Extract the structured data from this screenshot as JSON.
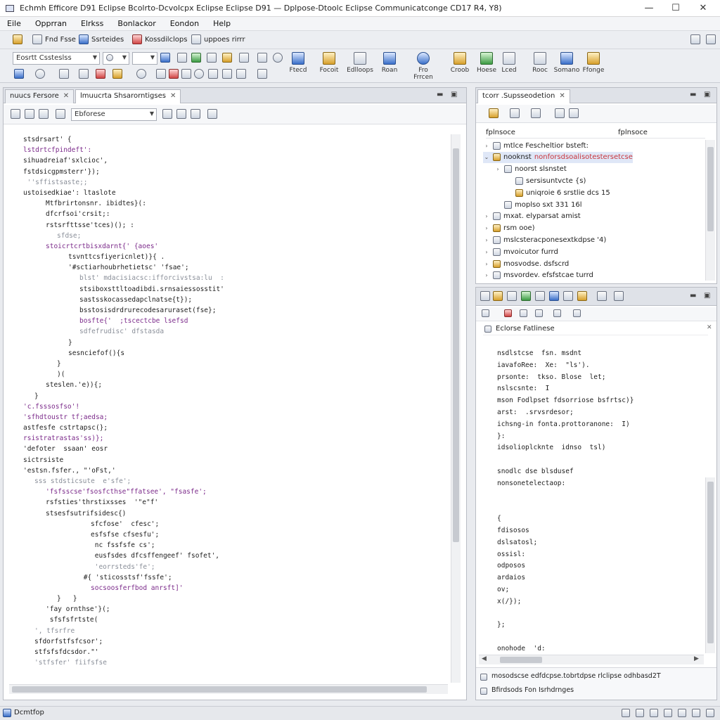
{
  "window": {
    "title": "Echmh Efficore D91 Eclipse Bcolrto-Dcvolcpx Eclipse Eclipse D91 — Dplpose-Dtoolc Eclipse Communicatconge CD17  R4, Y8)",
    "minimize": "—",
    "maximize": "☐",
    "close": "✕"
  },
  "menu": [
    "Eile",
    "Opprran",
    "Elrkss",
    "Bonlackor",
    "Eondon",
    "Help"
  ],
  "toolbar1": {
    "items": [
      "Fnd Fsse",
      "Ssrteides",
      "Kossdilclops",
      "uppoes rirrr"
    ]
  },
  "toolbar2": {
    "combo1": "Eosrtt Cssteslss",
    "combo2": "",
    "combo3": "",
    "big_buttons": [
      "Ftecd",
      "Focoit",
      "Edlloops",
      "Roan",
      "Fro Frrcen",
      "Croob",
      "Hoese",
      "Lced",
      "Rooc",
      "Somano",
      "Ffonge"
    ]
  },
  "editor": {
    "tabs": [
      {
        "label": "nuucs Fersore",
        "active": false
      },
      {
        "label": "lmuucrta Shsarorntigses",
        "active": true
      }
    ],
    "combo": "Ebforese",
    "lines": [
      {
        "indent": 2,
        "text": "stsdrsart' {",
        "color": "c-dark"
      },
      {
        "indent": 2,
        "text": "lstdrtcfpindeft':",
        "color": "c-purple"
      },
      {
        "indent": 2,
        "text": "sihuadreiaf'sxlcioc',",
        "color": "c-dark"
      },
      {
        "indent": 2,
        "text": "fstdsicgpmsterr'});",
        "color": "c-dark"
      },
      {
        "indent": 2,
        "text": " ''sffistsaste;;",
        "color": "c-grey"
      },
      {
        "indent": 2,
        "text": "ustoisedkiae': ltaslote",
        "color": "c-dark"
      },
      {
        "indent": 6,
        "text": "Mtfbrirtonsnr. ibidtes}(:",
        "color": "c-dark"
      },
      {
        "indent": 6,
        "text": "dfcrfsoi'crsit;:",
        "color": "c-dark"
      },
      {
        "indent": 6,
        "text": "rstsrfttsse'tces)(); :",
        "color": "c-dark"
      },
      {
        "indent": 8,
        "text": "sfdse;",
        "color": "c-grey"
      },
      {
        "indent": 6,
        "text": "stoicrtcrtbisxdarnt{' {aoes'",
        "color": "c-purple"
      },
      {
        "indent": 10,
        "text": "tsvnttcsfiyericnlet)}{ .",
        "color": "c-dark"
      },
      {
        "indent": 10,
        "text": "'#sctiarhoubrhetietsc' 'fsae';",
        "color": "c-dark"
      },
      {
        "indent": 12,
        "text": "blst' mdacisiacsc:ifforcivstsa:lu  :",
        "color": "c-grey"
      },
      {
        "indent": 12,
        "text": "stsiboxsttltoadibdi.srnsaiessosstit'",
        "color": "c-dark"
      },
      {
        "indent": 12,
        "text": "sastsskocassedapclnatse{t});",
        "color": "c-dark"
      },
      {
        "indent": 12,
        "text": "bsstosisdrdrurecodesaruraset(fse};",
        "color": "c-dark"
      },
      {
        "indent": 12,
        "text": "bosfte{'  ;tscectcbe lsefsd",
        "color": "c-purple"
      },
      {
        "indent": 12,
        "text": "sdfefrudisc' dfstasda",
        "color": "c-grey"
      },
      {
        "indent": 10,
        "text": "}",
        "color": "c-dark"
      },
      {
        "indent": 10,
        "text": "sesnciefof(){s",
        "color": "c-dark"
      },
      {
        "indent": 8,
        "text": "}",
        "color": "c-dark"
      },
      {
        "indent": 8,
        "text": ")(",
        "color": "c-dark"
      },
      {
        "indent": 6,
        "text": "steslen.'e)){;",
        "color": "c-dark"
      },
      {
        "indent": 4,
        "text": "}",
        "color": "c-dark"
      },
      {
        "indent": 2,
        "text": "'c.fsssosfso'!",
        "color": "c-purple"
      },
      {
        "indent": 2,
        "text": "'sfhdtoustr tf;aedsa;",
        "color": "c-purple"
      },
      {
        "indent": 2,
        "text": "astfesfe cstrtapsc(};",
        "color": "c-dark"
      },
      {
        "indent": 2,
        "text": "rsistratrastas'ss)};",
        "color": "c-purple"
      },
      {
        "indent": 2,
        "text": "'defoter  ssaan' eosr",
        "color": "c-dark"
      },
      {
        "indent": 2,
        "text": "sictrsiste",
        "color": "c-dark"
      },
      {
        "indent": 2,
        "text": "'estsn.fsfer., \"'oFst,'",
        "color": "c-dark"
      },
      {
        "indent": 4,
        "text": "sss stdsticsute  e'sfe';",
        "color": "c-grey"
      },
      {
        "indent": 6,
        "text": "'fsfsscse'fsosfcthse\"ffatsee', \"fsasfe';",
        "color": "c-purple"
      },
      {
        "indent": 6,
        "text": "rsfsties'thrstixsses  '\"e\"f'",
        "color": "c-dark"
      },
      {
        "indent": 6,
        "text": "stsesfsutrifsidesc{)",
        "color": "c-dark"
      },
      {
        "indent": 14,
        "text": "sfcfose'  cfesc';",
        "color": "c-dark"
      },
      {
        "indent": 14,
        "text": "esfsfse cfsesfu';",
        "color": "c-dark"
      },
      {
        "indent": 14,
        "text": " nc fssfsfe cs';",
        "color": "c-dark"
      },
      {
        "indent": 14,
        "text": " eusfsdes dfcsffengeef' fsofet',",
        "color": "c-dark"
      },
      {
        "indent": 14,
        "text": " 'eorrsteds'fe';",
        "color": "c-grey"
      },
      {
        "indent": 12,
        "text": " #{ 'sticosstsf'fssfe';",
        "color": "c-dark"
      },
      {
        "indent": 14,
        "text": "socsoosferfbod anrsft]'",
        "color": "c-purple"
      },
      {
        "indent": 8,
        "text": "}   }",
        "color": "c-dark"
      },
      {
        "indent": 6,
        "text": "'fay ornthse'}(;",
        "color": "c-dark"
      },
      {
        "indent": 6,
        "text": " sfsfsfrtste(",
        "color": "c-dark"
      },
      {
        "indent": 4,
        "text": "', tfsrfre",
        "color": "c-grey"
      },
      {
        "indent": 4,
        "text": "sfdorfstfsfcsor';",
        "color": "c-dark"
      },
      {
        "indent": 4,
        "text": "stfsfsfdcsdor.\"'",
        "color": "c-dark"
      },
      {
        "indent": 4,
        "text": "'stfsfer' fiifsfse",
        "color": "c-grey"
      }
    ]
  },
  "outline": {
    "tab": "tcorr .Supsseodetion",
    "header_left": "fplnsoce",
    "header_right": "fplnsoce",
    "rows": [
      {
        "depth": 0,
        "twisty": "›",
        "label": "mtlce Fescheltior bsteft:",
        "label2": "",
        "state": "normal"
      },
      {
        "depth": 0,
        "twisty": "⌄",
        "label": "nooknst",
        "label2": "nonforsdsoalisotestersetcse",
        "state": "sel-red"
      },
      {
        "depth": 1,
        "twisty": "›",
        "label": "noorst slsnstet",
        "label2": "",
        "state": "normal"
      },
      {
        "depth": 2,
        "twisty": "",
        "label": "sersisuntvcte  {s)",
        "label2": "",
        "state": "normal"
      },
      {
        "depth": 2,
        "twisty": "",
        "label": "uniqroie  6 srstlie dcs  15",
        "label2": "",
        "state": "normal"
      },
      {
        "depth": 1,
        "twisty": "",
        "label": "moplso sxt  331  16l",
        "label2": "",
        "state": "normal"
      },
      {
        "depth": 0,
        "twisty": "›",
        "label": "mxat. elyparsat amist",
        "label2": "",
        "state": "normal"
      },
      {
        "depth": 0,
        "twisty": "›",
        "label": "rsm ooe)",
        "label2": "",
        "state": "normal"
      },
      {
        "depth": 0,
        "twisty": "›",
        "label": "mslcsteracponesextkdpse  '4)",
        "label2": "",
        "state": "normal"
      },
      {
        "depth": 0,
        "twisty": "›",
        "label": "mvoicutor  furrd",
        "label2": "",
        "state": "normal"
      },
      {
        "depth": 0,
        "twisty": "›",
        "label": "mosvodse.  dsfscrd",
        "label2": "",
        "state": "normal"
      },
      {
        "depth": 0,
        "twisty": "›",
        "label": "msvordev. efsfstcae  turrd",
        "label2": "",
        "state": "normal"
      }
    ]
  },
  "console": {
    "title": "Eclorse Fatlinese",
    "lines": [
      "nsdlstcse  fsn. msdnt",
      "iavafoRee:  Xe:  \"ls').",
      "prsonte:  tkso. Blose  let;",
      "nslscsnte:  I",
      "mson Fodlpset fdsorriose bsfrtsc)}",
      "arst:  .srvsrdesor;",
      "ichsng-in fonta.prottoranone:  I)",
      "}:",
      "idsolioplcknte  idnso  tsl)",
      "",
      "snodlc dse blsdusef",
      "nonsonetelectaop:",
      "",
      "",
      "{",
      "fdisosos",
      "dslsatosl;",
      "ossisl:",
      "odposos",
      "ardaios",
      "ov;",
      "x(/});",
      "",
      "};",
      "",
      "onohode  'd;"
    ],
    "footer_line1": "mosodscse edfdcpse.tobrtdpse  rlclipse  odhbasd2T",
    "footer_line2": "Bfirdsods Fon  Isrhdrnges"
  },
  "status": {
    "left": "Dcmtfop"
  }
}
